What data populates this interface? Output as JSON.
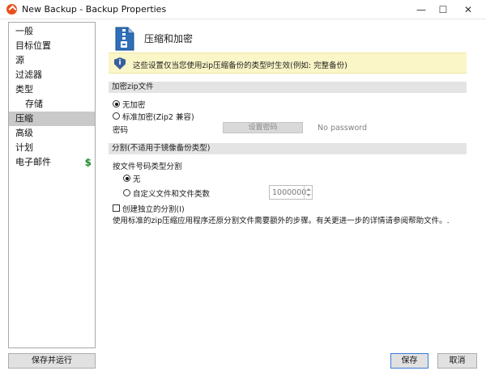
{
  "window": {
    "title": "New Backup - Backup Properties",
    "minimize": "—",
    "maximize": "☐",
    "close": "✕"
  },
  "sidebar": {
    "items": [
      {
        "label": "一般",
        "selected": false,
        "indent": false
      },
      {
        "label": "目标位置",
        "selected": false,
        "indent": false
      },
      {
        "label": "源",
        "selected": false,
        "indent": false
      },
      {
        "label": "过滤器",
        "selected": false,
        "indent": false
      },
      {
        "label": "类型",
        "selected": false,
        "indent": false
      },
      {
        "label": "存储",
        "selected": false,
        "indent": true
      },
      {
        "label": "压缩",
        "selected": true,
        "indent": false
      },
      {
        "label": "高级",
        "selected": false,
        "indent": false
      },
      {
        "label": "计划",
        "selected": false,
        "indent": false
      },
      {
        "label": "电子邮件",
        "selected": false,
        "indent": false,
        "badge": "$"
      }
    ]
  },
  "header": {
    "icon": "zip-file-icon",
    "title": "压缩和加密"
  },
  "info": {
    "icon": "shield-info-icon",
    "text": "这些设置仅当您使用zip压缩备份的类型时生效(例如: 完整备份)"
  },
  "encryption": {
    "section_title": "加密zip文件",
    "options": [
      {
        "label": "无加密",
        "checked": true
      },
      {
        "label": "标准加密(Zip2 兼容)",
        "checked": false
      }
    ],
    "password_label": "密码",
    "set_password_button": "设置密码",
    "password_status": "No password"
  },
  "split": {
    "section_title": "分割(不适用于镜像备份类型)",
    "subtitle": "按文件号码类型分割",
    "options": [
      {
        "label": "无",
        "checked": true
      },
      {
        "label": "自定义文件和文件类数",
        "checked": false
      }
    ],
    "custom_value": "1000000",
    "independent_split_label": "创建独立的分割(I)",
    "independent_split_checked": false,
    "help_text": "使用标准的zip压缩应用程序还原分割文件需要额外的步骤。有关更进一步的详情请参阅帮助文件。."
  },
  "footer": {
    "save_and_run": "保存并运行",
    "save": "保存",
    "cancel": "取消"
  },
  "colors": {
    "banner_bg": "#fbf6c7",
    "selected_nav": "#c9c9c9",
    "section_bg": "#e4e4e4",
    "dollar": "#1a8a2a",
    "app_icon": "#e8501c"
  }
}
